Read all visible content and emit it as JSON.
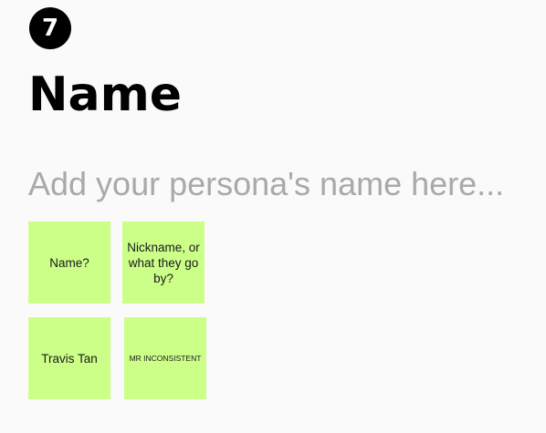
{
  "step": {
    "number": "7"
  },
  "section": {
    "title": "Name",
    "input_placeholder": "Add your persona's name here...",
    "input_value": ""
  },
  "sticky_notes": [
    {
      "text": "Name?",
      "color": "#ccff88"
    },
    {
      "text": "Nickname, or what they go by?",
      "color": "#ccff88"
    },
    {
      "text": "Travis Tan",
      "color": "#ccff88"
    },
    {
      "text": "MR INCONSISTENT",
      "color": "#ccff88"
    }
  ],
  "colors": {
    "background": "#fafafa",
    "title": "#000000",
    "placeholder": "#a9a9a9",
    "sticky_note": "#ccff88"
  }
}
